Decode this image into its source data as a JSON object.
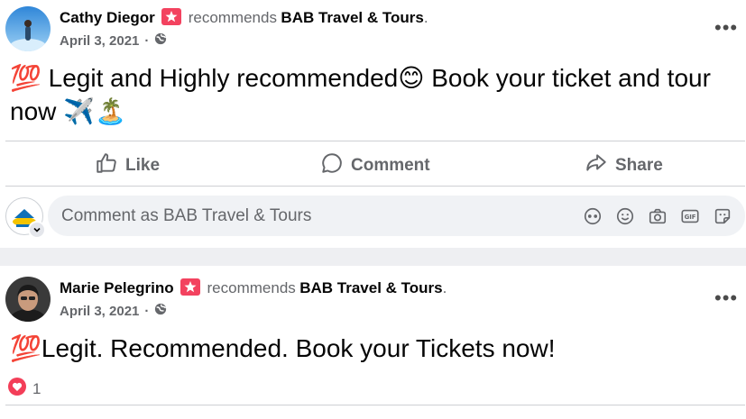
{
  "post1": {
    "author": "Cathy Diegor",
    "action_text": "recommends",
    "page": "BAB Travel & Tours",
    "trailing": ".",
    "date": "April 3, 2021",
    "emoji_100": "💯",
    "text_part1": " Legit and Highly recommended",
    "emoji_smile": "😊",
    "text_part2": " Book your ticket and tour now ",
    "emoji_tail": "✈️🏝️"
  },
  "actions": {
    "like": "Like",
    "comment": "Comment",
    "share": "Share"
  },
  "comment_box": {
    "placeholder": "Comment as BAB Travel & Tours"
  },
  "post2": {
    "author": "Marie Pelegrino",
    "action_text": "recommends",
    "page": "BAB Travel & Tours",
    "trailing": ".",
    "date": "April 3, 2021",
    "emoji_100": "💯",
    "text": "Legit. Recommended. Book your Tickets now!",
    "reaction_count": "1"
  },
  "colors": {
    "accent": "#f3425f",
    "secondary_text": "#65676b",
    "divider": "#ced0d4",
    "input_bg": "#f0f2f5"
  }
}
